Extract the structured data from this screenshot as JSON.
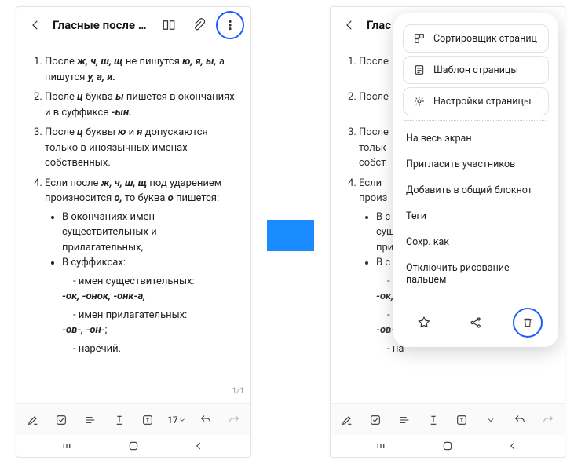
{
  "title": "Гласные после шип…",
  "title2": "Глас",
  "pagecount": "1/1",
  "tool_fontsize": "17",
  "rules": {
    "r1_a": "После ",
    "r1_b": "ж, ч, ш, щ",
    "r1_c": " не пишутся ",
    "r1_d": "ю, я, ы,",
    "r1_e": " а пишутся ",
    "r1_f": "у, а, и.",
    "r2_a": "После ",
    "r2_b": "ц",
    "r2_c": " буква ",
    "r2_d": "ы",
    "r2_e": " пишется в окончаниях и в суффиксе ",
    "r2_f": "-ын.",
    "r3_a": "После ",
    "r3_b": "ц",
    "r3_c": " буквы ",
    "r3_d": "ю",
    "r3_e": " и ",
    "r3_f": "я",
    "r3_g": " допускаются только в иноязычных именах собственных.",
    "r4_a": "Если после ",
    "r4_b": "ж, ч, ш, щ",
    "r4_c": " под ударением произносится ",
    "r4_d": "о,",
    "r4_e": " то буква ",
    "r4_f": "о",
    "r4_g": " пишется:",
    "b1": "В окончаниях имен существительных и прилагательных,",
    "b2": "В суффиксах:",
    "d1": "имен существительных:",
    "d1s": "-ок, -онок, -онк-а,",
    "d2": "имен прилагательных:",
    "d2s": "-ов-, -он-",
    "d3": "наречий."
  },
  "leftnote_suffix": ";",
  "menu": {
    "m1": "Сортировщик страниц",
    "m2": "Шаблон страницы",
    "m3": "Настройки страницы",
    "m4": "На весь экран",
    "m5": "Пригласить участников",
    "m6": "Добавить в общий блокнот",
    "m7": "Теги",
    "m8": "Сохр. как",
    "m9": "Отключить рисование пальцем"
  }
}
